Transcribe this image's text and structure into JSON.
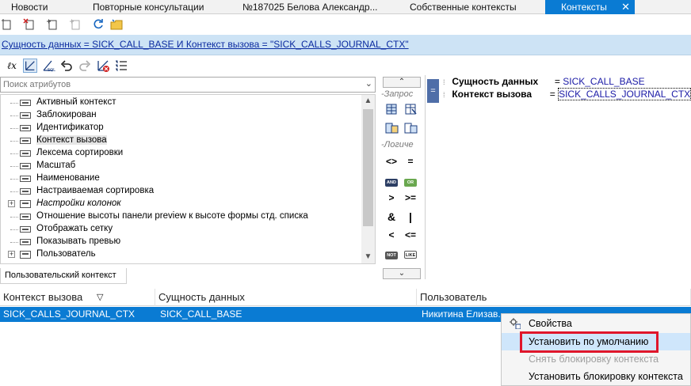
{
  "tabs": [
    {
      "label": "Новости",
      "active": false
    },
    {
      "label": "Повторные консультации",
      "active": false
    },
    {
      "label": "№187025 Белова Александр...",
      "active": false
    },
    {
      "label": "Собственные контексты",
      "active": false
    },
    {
      "label": "Контексты",
      "active": true
    }
  ],
  "tab_close": "✕",
  "filter_link": "Сущность данных = SICK_CALL_BASE И Контекст вызова = \"SICK_CALLS_JOURNAL_CTX\"",
  "search": {
    "placeholder": "Поиск атрибутов"
  },
  "tree": [
    {
      "label": "Активный контекст",
      "expandable": false,
      "italic": false
    },
    {
      "label": "Заблокирован",
      "expandable": false,
      "italic": false
    },
    {
      "label": "Идентификатор",
      "expandable": false,
      "italic": false
    },
    {
      "label": "Контекст вызова",
      "expandable": false,
      "italic": false,
      "selected": true
    },
    {
      "label": "Лексема сортировки",
      "expandable": false,
      "italic": false
    },
    {
      "label": "Масштаб",
      "expandable": false,
      "italic": false
    },
    {
      "label": "Наименование",
      "expandable": false,
      "italic": false
    },
    {
      "label": "Настраиваемая сортировка",
      "expandable": false,
      "italic": false
    },
    {
      "label": "Настройки колонок",
      "expandable": true,
      "italic": true
    },
    {
      "label": "Отношение высоты панели preview к высоте формы стд. списка",
      "expandable": false,
      "italic": false
    },
    {
      "label": "Отображать сетку",
      "expandable": false,
      "italic": false
    },
    {
      "label": "Показывать превью",
      "expandable": false,
      "italic": false
    },
    {
      "label": "Пользователь",
      "expandable": true,
      "italic": false
    }
  ],
  "bottom_tab": "Пользовательский контекст",
  "ops": {
    "query_caption": "-Запрос",
    "logic_caption": "-Логиче",
    "and_label": "AND",
    "or_label": "OR",
    "not_label": "NOT",
    "like_label": "LIKE",
    "op_neq": "<>",
    "op_eq": "=",
    "op_gt": ">",
    "op_gte": ">=",
    "op_amp": "&",
    "op_pipe": "|",
    "op_lt": "<",
    "op_lte": "<="
  },
  "expression": {
    "eq_marker": "=",
    "rows": [
      {
        "attr": "Сущность данных",
        "op": "=",
        "value": "SICK_CALL_BASE"
      },
      {
        "attr": "Контекст вызова",
        "op": "=",
        "value": "SICK_CALLS_JOURNAL_CTX"
      }
    ]
  },
  "grid": {
    "columns": [
      "Контекст вызова",
      "Сущность данных",
      "Пользователь"
    ],
    "rows": [
      [
        "SICK_CALLS_JOURNAL_CTX",
        "SICK_CALL_BASE",
        "Никитина Елизав..."
      ]
    ]
  },
  "context_menu": [
    {
      "label": "Свойства",
      "disabled": false,
      "highlighted": false
    },
    {
      "label": "Установить по умолчанию",
      "disabled": false,
      "highlighted": true
    },
    {
      "label": "Снять блокировку контекста",
      "disabled": true,
      "highlighted": false
    },
    {
      "label": "Установить блокировку контекста",
      "disabled": false,
      "highlighted": false
    }
  ],
  "colors": {
    "accent": "#0a7bd3",
    "highlight_border": "#e0162b",
    "crumb_bg": "#cde3f5"
  }
}
